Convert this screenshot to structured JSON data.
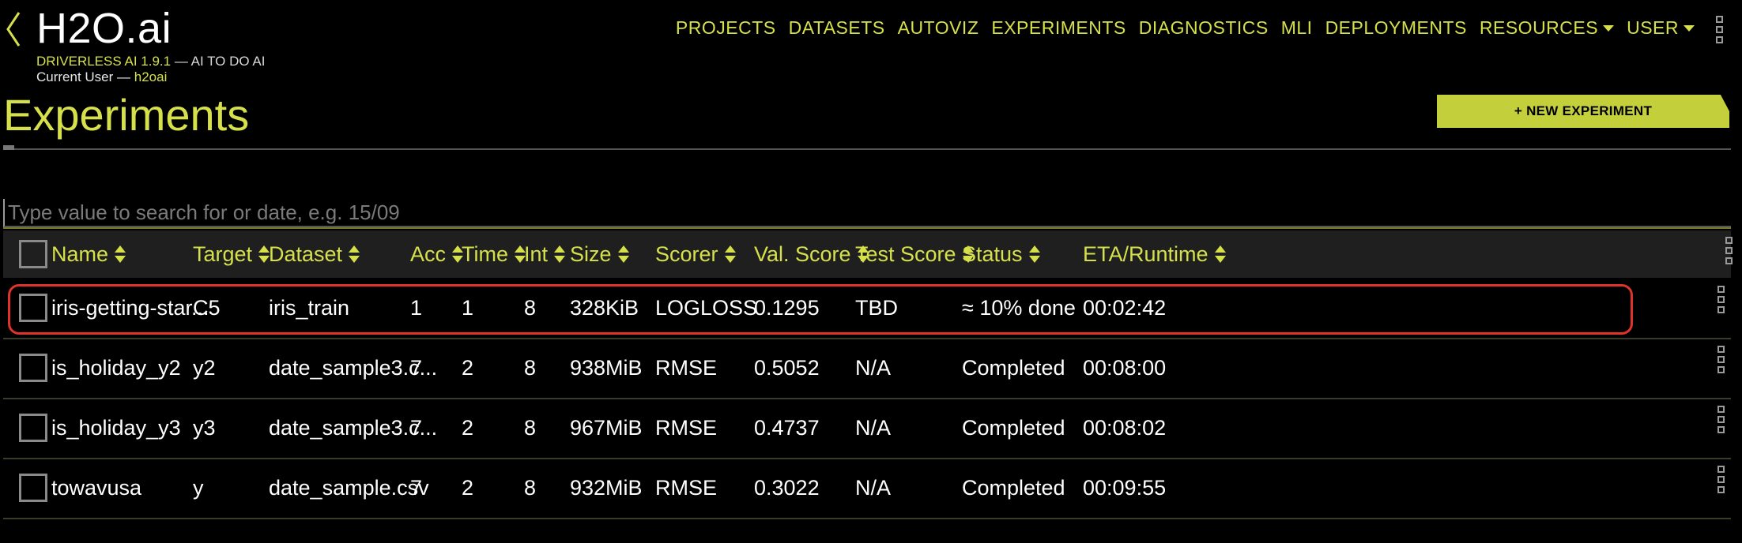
{
  "brand": {
    "title": "H2O.ai",
    "product": "DRIVERLESS AI 1.9.1",
    "tagline": " — AI TO DO AI",
    "user_label": "Current User — ",
    "user_name": "h2oai"
  },
  "nav": {
    "items": [
      {
        "label": "PROJECTS",
        "dropdown": false
      },
      {
        "label": "DATASETS",
        "dropdown": false
      },
      {
        "label": "AUTOVIZ",
        "dropdown": false
      },
      {
        "label": "EXPERIMENTS",
        "dropdown": false
      },
      {
        "label": "DIAGNOSTICS",
        "dropdown": false
      },
      {
        "label": "MLI",
        "dropdown": false
      },
      {
        "label": "DEPLOYMENTS",
        "dropdown": false
      },
      {
        "label": "RESOURCES",
        "dropdown": true
      },
      {
        "label": "USER",
        "dropdown": true
      }
    ]
  },
  "page": {
    "title": "Experiments",
    "new_button": "+ NEW EXPERIMENT"
  },
  "search": {
    "placeholder": "Type value to search for or date, e.g. 15/09",
    "value": ""
  },
  "table": {
    "columns": [
      "Name",
      "Target",
      "Dataset",
      "Acc",
      "Time",
      "Int",
      "Size",
      "Scorer",
      "Val. Score",
      "Test Score",
      "Status",
      "ETA/Runtime"
    ],
    "rows": [
      {
        "name": "iris-getting-star...",
        "target": "C5",
        "dataset": "iris_train",
        "acc": "1",
        "time": "1",
        "int": "8",
        "size": "328KiB",
        "scorer": "LOGLOSS",
        "val_score": "0.1295",
        "test_score": "TBD",
        "status": "≈ 10% done",
        "eta": "00:02:42"
      },
      {
        "name": "is_holiday_y2",
        "target": "y2",
        "dataset": "date_sample3.c...",
        "acc": "7",
        "time": "2",
        "int": "8",
        "size": "938MiB",
        "scorer": "RMSE",
        "val_score": "0.5052",
        "test_score": "N/A",
        "status": "Completed",
        "eta": "00:08:00"
      },
      {
        "name": "is_holiday_y3",
        "target": "y3",
        "dataset": "date_sample3.c...",
        "acc": "7",
        "time": "2",
        "int": "8",
        "size": "967MiB",
        "scorer": "RMSE",
        "val_score": "0.4737",
        "test_score": "N/A",
        "status": "Completed",
        "eta": "00:08:02"
      },
      {
        "name": "towavusa",
        "target": "y",
        "dataset": "date_sample.csv",
        "acc": "7",
        "time": "2",
        "int": "8",
        "size": "932MiB",
        "scorer": "RMSE",
        "val_score": "0.3022",
        "test_score": "N/A",
        "status": "Completed",
        "eta": "00:09:55"
      }
    ]
  },
  "colors": {
    "accent": "#d6e04a",
    "button": "#c4cf3c",
    "highlight": "#e0332b",
    "background": "#000000"
  }
}
